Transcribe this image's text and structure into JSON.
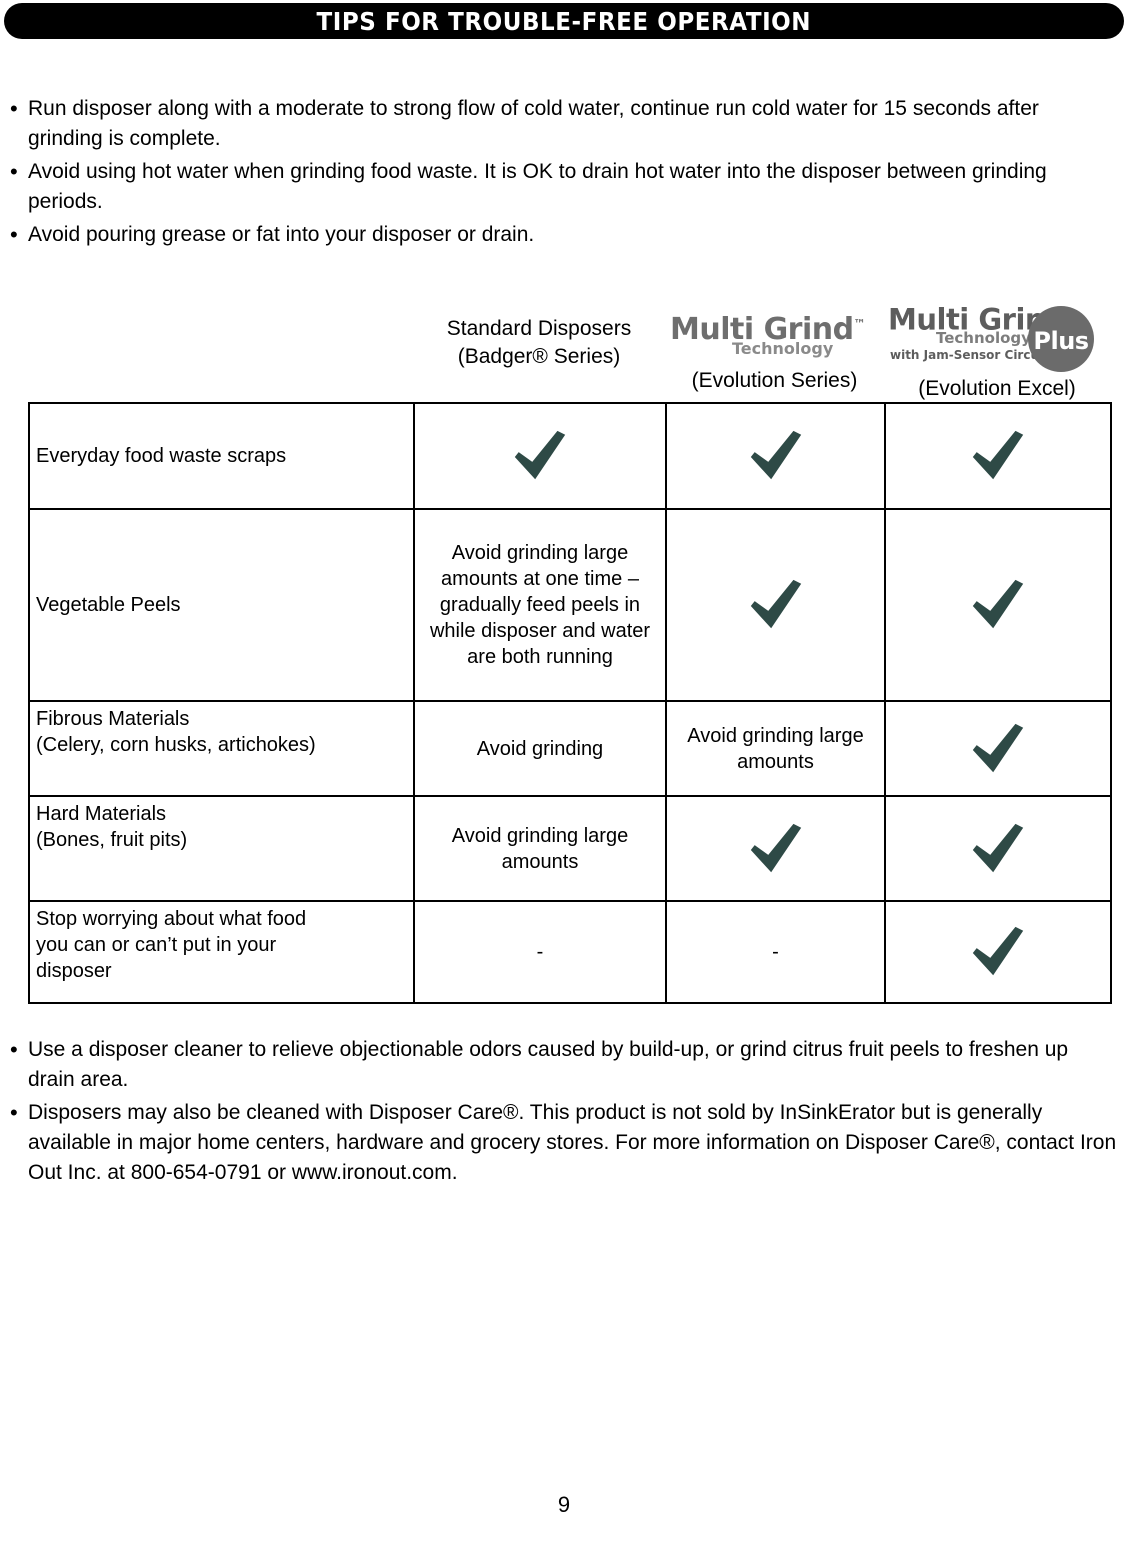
{
  "header": {
    "title": "TIPS FOR TROUBLE-FREE OPERATION"
  },
  "bullets_top": [
    "Run disposer along with a moderate to strong flow of cold water, continue run cold water for 15 seconds after grinding is complete.",
    "Avoid using hot water when grinding food waste. It is OK to drain hot water into the disposer between grinding periods.",
    "Avoid pouring grease or fat into your disposer or drain."
  ],
  "bullets_bottom": [
    "Use a disposer cleaner to relieve objectionable odors caused by build-up, or grind citrus fruit peels to freshen up drain area.",
    "Disposers may also be cleaned with Disposer Care®. This product is not sold by InSinkErator but is generally available in major home centers, hardware and grocery stores. For more information on Disposer Care®, contact Iron Out Inc. at 800-654-0791 or www.ironout.com."
  ],
  "table": {
    "headers": {
      "standard_line1": "Standard Disposers",
      "standard_line2": "(Badger® Series)",
      "evolution_series_label": "(Evolution Series)",
      "evolution_excel_label": "(Evolution Excel)"
    },
    "logo_multigrind": {
      "main": "Multi Grind",
      "tm": "™",
      "sub": "Technology"
    },
    "logo_multigrind_plus": {
      "main": "Multi Grind",
      "tm": "™",
      "sub": "Technology",
      "sub2": "with Jam-Sensor Circuit™",
      "badge": "Plus"
    },
    "rows": [
      {
        "label": "Everyday food waste scraps",
        "standard": "check",
        "evolution_series": "check",
        "evolution_excel": "check"
      },
      {
        "label": "Vegetable Peels",
        "standard": "Avoid grinding large amounts at one time – gradually feed peels in while disposer and water are both running",
        "evolution_series": "check",
        "evolution_excel": "check"
      },
      {
        "label": "Fibrous Materials\n(Celery, corn husks, artichokes)",
        "label_line1": "Fibrous Materials",
        "label_line2": "(Celery, corn husks, artichokes)",
        "standard": "Avoid grinding",
        "evolution_series": "Avoid grinding large amounts",
        "evolution_excel": "check"
      },
      {
        "label_line1": "Hard Materials",
        "label_line2": "(Bones, fruit pits)",
        "standard": "Avoid grinding large amounts",
        "evolution_series": "check",
        "evolution_excel": "check"
      },
      {
        "label_line1": "Stop worrying about what food",
        "label_line2": "you can or can’t put in your",
        "label_line3": "disposer",
        "standard": "-",
        "evolution_series": "-",
        "evolution_excel": "check"
      }
    ]
  },
  "colors": {
    "check_green": "#2e4a46",
    "header_bar": "#000000",
    "logo_gray": "#6e6e6e"
  },
  "page_number": "9"
}
